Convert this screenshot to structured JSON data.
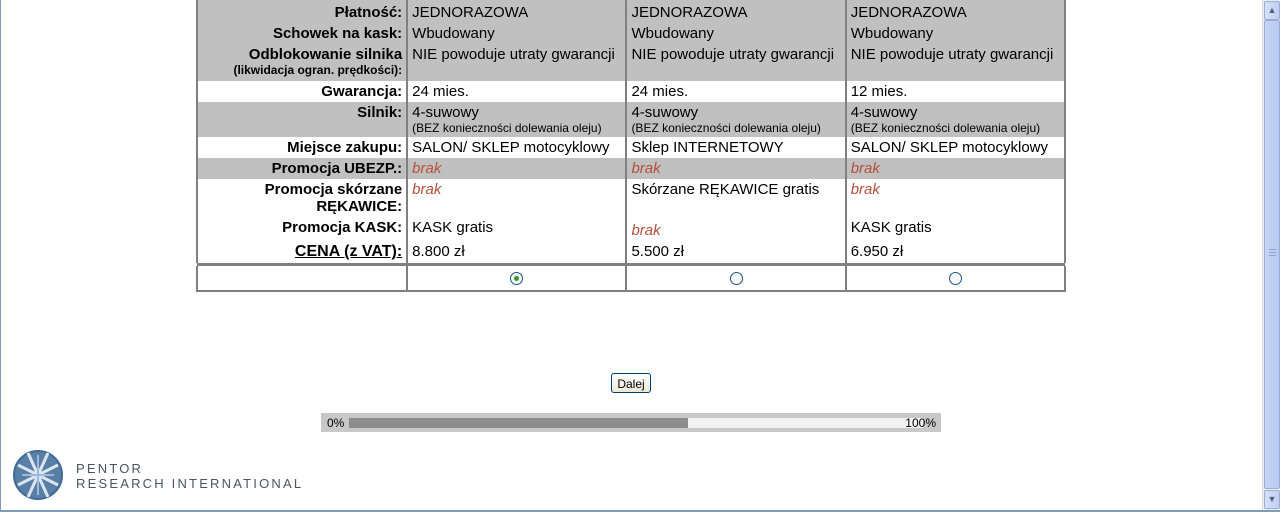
{
  "table": {
    "rows": [
      {
        "label": "Płatność:",
        "c1": "JEDNORAZOWA",
        "c2": "JEDNORAZOWA",
        "c3": "JEDNORAZOWA"
      },
      {
        "label": "Schowek na kask:",
        "c1": "Wbudowany",
        "c2": "Wbudowany",
        "c3": "Wbudowany"
      },
      {
        "label": "Odblokowanie silnika",
        "label_sub": "(likwidacja ogran. prędkości):",
        "c1": "NIE powoduje utraty gwarancji",
        "c2": "NIE powoduje utraty gwarancji",
        "c3": "NIE powoduje utraty gwarancji"
      },
      {
        "label": "Gwarancja:",
        "c1": "24 mies.",
        "c2": "24 mies.",
        "c3": "12 mies."
      },
      {
        "label": "Silnik:",
        "c1": "4-suwowy",
        "c1_sub": "(BEZ konieczności dolewania oleju)",
        "c2": "4-suwowy",
        "c2_sub": "(BEZ konieczności dolewania oleju)",
        "c3": "4-suwowy",
        "c3_sub": "(BEZ konieczności dolewania oleju)"
      },
      {
        "label": "Miejsce zakupu:",
        "c1": "SALON/ SKLEP motocyklowy",
        "c2": "Sklep INTERNETOWY",
        "c3": "SALON/ SKLEP motocyklowy"
      },
      {
        "label": "Promocja UBEZP.:",
        "c1": "brak",
        "c2": "brak",
        "c3": "brak"
      },
      {
        "label": "Promocja skórzane RĘKAWICE:",
        "c1": "brak",
        "c2": "Skórzane RĘKAWICE gratis",
        "c3": "brak"
      },
      {
        "label": "Promocja KASK:",
        "c1": "KASK gratis",
        "c2": "brak",
        "c3": "KASK gratis"
      },
      {
        "label": "CENA (z VAT):",
        "c1": "8.800 zł",
        "c2": "5.500 zł",
        "c3": "6.950 zł"
      }
    ],
    "selected_option": 1
  },
  "buttons": {
    "next_label": "Dalej"
  },
  "progress": {
    "min_label": "0%",
    "max_label": "100%",
    "value_percent": 59
  },
  "logo": {
    "line1": "PENTOR",
    "line2": "RESEARCH INTERNATIONAL"
  }
}
